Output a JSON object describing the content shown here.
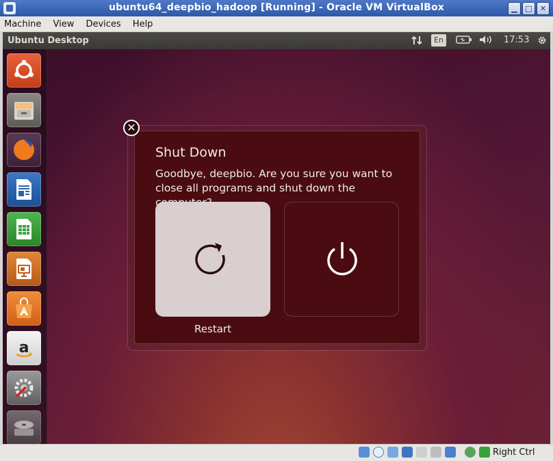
{
  "window": {
    "title": "ubuntu64_deepbio_hadoop [Running] - Oracle VM VirtualBox",
    "minimize_glyph": "▁",
    "maximize_glyph": "□",
    "close_glyph": "✕"
  },
  "menubar": {
    "items": [
      "Machine",
      "View",
      "Devices",
      "Help"
    ]
  },
  "panel": {
    "title": "Ubuntu Desktop",
    "network_icon": "transfer-arrows-icon",
    "language": "En",
    "battery_icon": "battery-icon",
    "volume_icon": "volume-icon",
    "time": "17:53",
    "settings_icon": "gear-icon"
  },
  "launcher": {
    "items": [
      {
        "name": "dash-home",
        "icon": "ubuntu-logo-icon",
        "color": "#d7491f"
      },
      {
        "name": "files",
        "icon": "file-cabinet-icon",
        "color": "#8a8781"
      },
      {
        "name": "firefox",
        "icon": "firefox-icon",
        "color": "#e25b1a"
      },
      {
        "name": "libreoffice-writer",
        "icon": "writer-icon",
        "color": "#2a63b0"
      },
      {
        "name": "libreoffice-calc",
        "icon": "calc-icon",
        "color": "#3aa53a"
      },
      {
        "name": "libreoffice-impress",
        "icon": "impress-icon",
        "color": "#d06b1f"
      },
      {
        "name": "software-center",
        "icon": "shopping-bag-icon",
        "color": "#e8722c"
      },
      {
        "name": "amazon",
        "icon": "amazon-icon",
        "color": "#f0f0f0"
      },
      {
        "name": "system-settings",
        "icon": "settings-wrench-icon",
        "color": "#7a7a7a"
      },
      {
        "name": "dvd-drive",
        "icon": "disc-icon",
        "color": "#9a9a9a"
      }
    ]
  },
  "dialog": {
    "title": "Shut Down",
    "message": "Goodbye, deepbio. Are you sure you want to close all programs and shut down the computer?",
    "restart_label": "Restart",
    "close_glyph": "✕",
    "restart_icon": "restart-icon",
    "power_icon": "power-icon"
  },
  "statusbar": {
    "host_key": "Right Ctrl",
    "icons": [
      "hard-disk-icon",
      "optical-drive-icon",
      "usb-icon",
      "network-icon",
      "shared-folder-icon",
      "display-icon",
      "video-capture-icon",
      "virtualization-icon",
      "mouse-integration-icon",
      "keyboard-capture-icon"
    ]
  },
  "colors": {
    "titlebar": "#3a66b4",
    "dialog_bg": "#4a0c10",
    "restart_card": "#d9cfd0",
    "panel_bg": "#3b3a36"
  }
}
